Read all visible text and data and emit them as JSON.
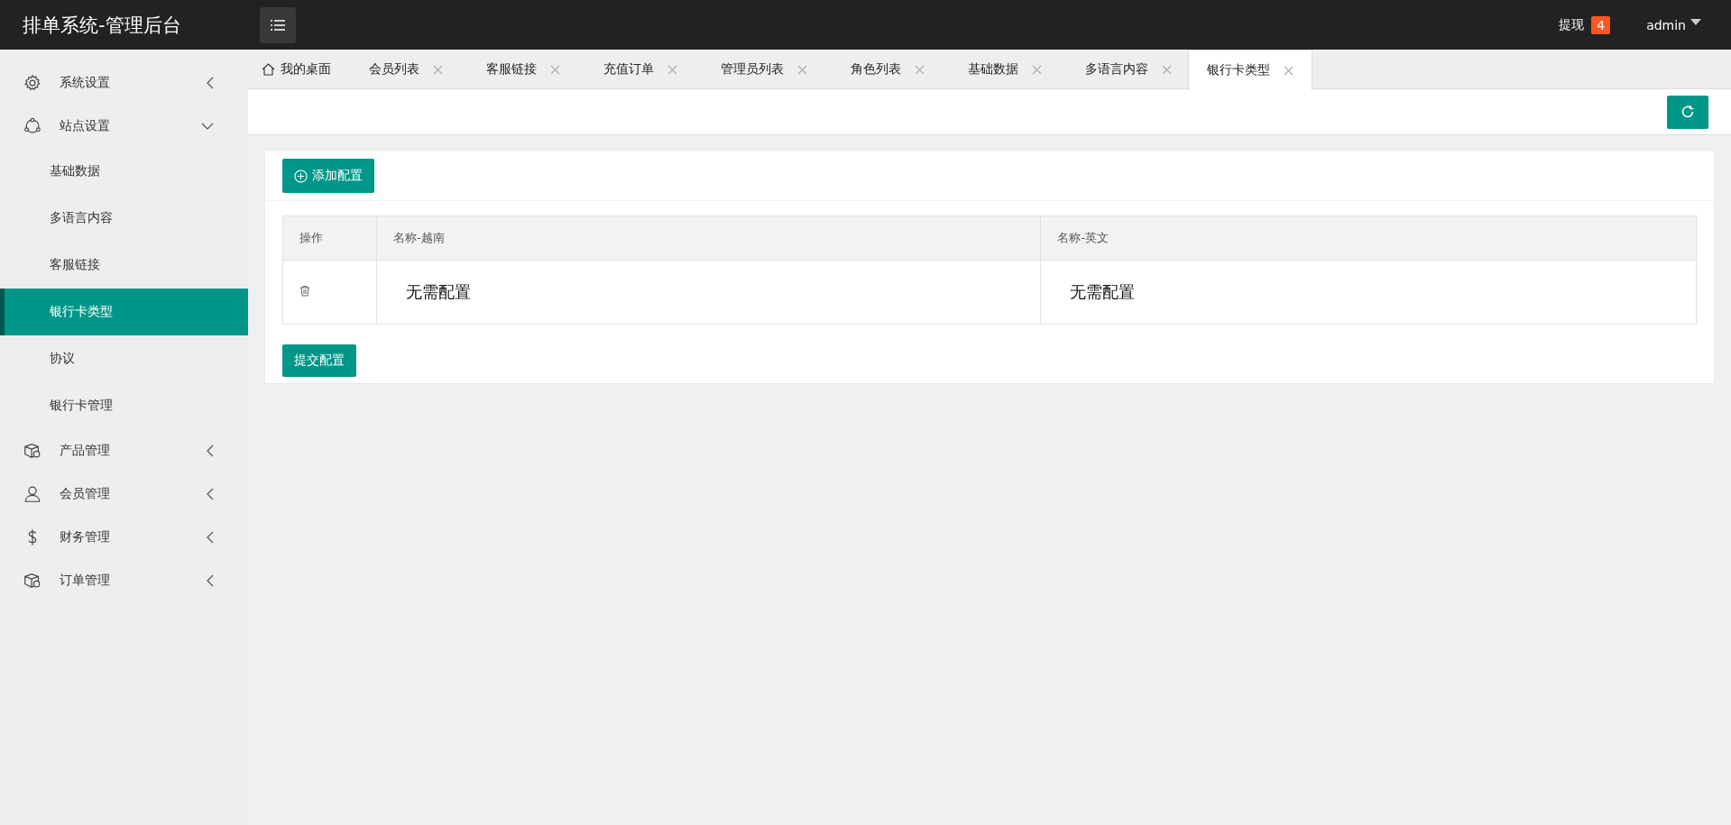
{
  "header": {
    "title": "排单系统-管理后台",
    "withdraw_label": "提现",
    "withdraw_badge": "4",
    "user": "admin"
  },
  "sidebar": {
    "items": [
      {
        "label": "系统设置",
        "kind": "gear",
        "expanded": false
      },
      {
        "label": "站点设置",
        "kind": "network",
        "expanded": true,
        "children": [
          {
            "label": "基础数据",
            "selected": false
          },
          {
            "label": "多语言内容",
            "selected": false
          },
          {
            "label": "客服链接",
            "selected": false
          },
          {
            "label": "银行卡类型",
            "selected": true
          },
          {
            "label": "协议",
            "selected": false
          },
          {
            "label": "银行卡管理",
            "selected": false
          }
        ]
      },
      {
        "label": "产品管理",
        "kind": "box",
        "expanded": false
      },
      {
        "label": "会员管理",
        "kind": "user",
        "expanded": false
      },
      {
        "label": "财务管理",
        "kind": "dollar",
        "expanded": false
      },
      {
        "label": "订单管理",
        "kind": "box",
        "expanded": false
      }
    ]
  },
  "tabs": [
    {
      "label": "我的桌面",
      "kind": "home",
      "selected": false
    },
    {
      "label": "会员列表",
      "kind": "closable",
      "selected": false
    },
    {
      "label": "客服链接",
      "kind": "closable",
      "selected": false
    },
    {
      "label": "充值订单",
      "kind": "closable",
      "selected": false
    },
    {
      "label": "管理员列表",
      "kind": "closable",
      "selected": false
    },
    {
      "label": "角色列表",
      "kind": "closable",
      "selected": false
    },
    {
      "label": "基础数据",
      "kind": "closable",
      "selected": false
    },
    {
      "label": "多语言内容",
      "kind": "closable",
      "selected": false
    },
    {
      "label": "银行卡类型",
      "kind": "closable",
      "selected": true
    }
  ],
  "panel": {
    "add_button": "添加配置",
    "submit_button": "提交配置",
    "table": {
      "columns": [
        "操作",
        "名称-越南",
        "名称-英文"
      ],
      "rows": [
        {
          "cells": [
            "",
            "无需配置",
            "无需配置"
          ]
        }
      ]
    }
  }
}
